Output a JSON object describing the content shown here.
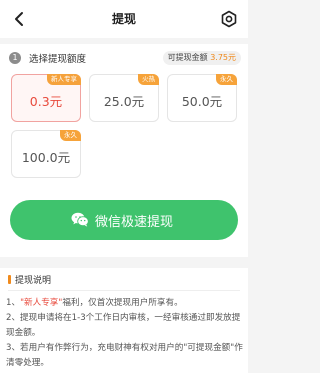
{
  "header": {
    "title": "提现"
  },
  "step": {
    "number": "1",
    "label": "选择提现额度"
  },
  "balance": {
    "label": "可提现金额",
    "amount": "3.75元"
  },
  "options": [
    {
      "amount": "0.3元",
      "badge": "新人专享",
      "selected": true
    },
    {
      "amount": "25.0元",
      "badge": "火热",
      "selected": false
    },
    {
      "amount": "50.0元",
      "badge": "永久",
      "selected": false
    },
    {
      "amount": "100.0元",
      "badge": "永久",
      "selected": false
    }
  ],
  "withdraw_button": {
    "label": "微信极速提现"
  },
  "info": {
    "title": "提现说明",
    "line1_prefix": "1、",
    "line1_highlight": "\"新人专享\"",
    "line1_rest": "福利，仅首次提现用户所享有。",
    "line2": "2、提现申请将在1-3个工作日内审核，一经审核通过即发放提现金额。",
    "line3": "3、若用户有作弊行为，充电财神有权对用户的\"可提现金额\"作清零处理。"
  },
  "colors": {
    "accent": "#f08a1c",
    "selected": "#e84a3c",
    "wechat_green": "#3fc36d"
  }
}
